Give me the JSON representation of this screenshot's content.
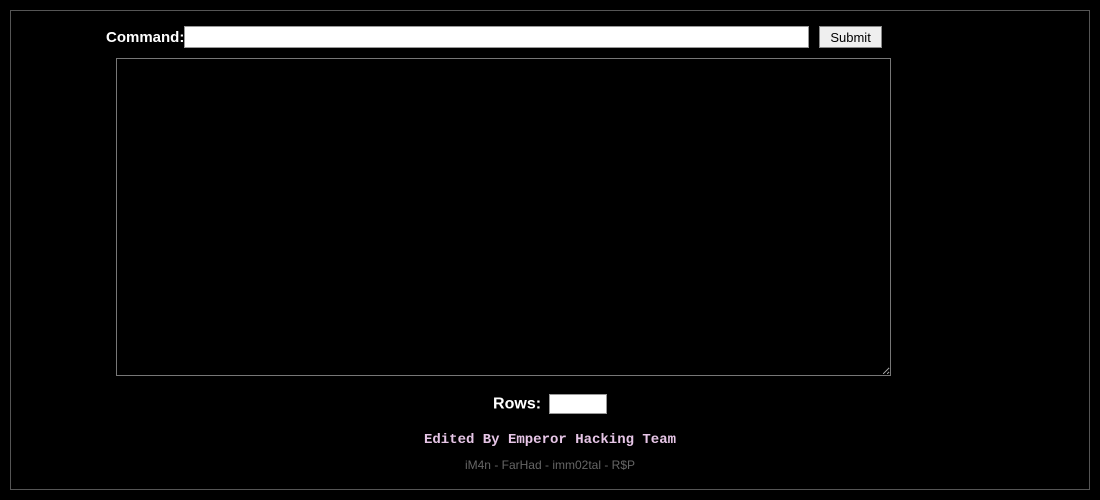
{
  "form": {
    "command_label": "Command:",
    "command_value": "",
    "submit_label": "Submit",
    "output_value": "",
    "rows_label": "Rows:",
    "rows_value": ""
  },
  "footer": {
    "credits": "Edited By Emperor Hacking Team",
    "names": "iM4n - FarHad - imm02tal - R$P"
  }
}
